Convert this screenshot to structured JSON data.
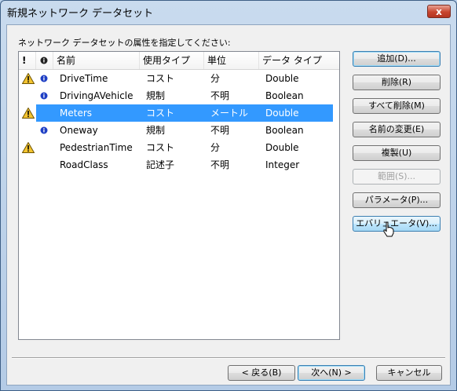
{
  "window": {
    "title": "新規ネットワーク データセット",
    "close_label": "x"
  },
  "prompt": "ネットワーク データセットの属性を指定してください:",
  "columns": {
    "col1": "!",
    "col3": "名前",
    "col4": "使用タイプ",
    "col5": "単位",
    "col6": "データ タイプ"
  },
  "rows": [
    {
      "name": "DriveTime",
      "usage": "コスト",
      "units": "分",
      "dtype": "Double",
      "warning": true,
      "info": true,
      "selected": false
    },
    {
      "name": "DrivingAVehicle",
      "usage": "規制",
      "units": "不明",
      "dtype": "Boolean",
      "warning": false,
      "info": true,
      "selected": false
    },
    {
      "name": "Meters",
      "usage": "コスト",
      "units": "メートル",
      "dtype": "Double",
      "warning": true,
      "info": false,
      "selected": true
    },
    {
      "name": "Oneway",
      "usage": "規制",
      "units": "不明",
      "dtype": "Boolean",
      "warning": false,
      "info": true,
      "selected": false
    },
    {
      "name": "PedestrianTime",
      "usage": "コスト",
      "units": "分",
      "dtype": "Double",
      "warning": true,
      "info": false,
      "selected": false
    },
    {
      "name": "RoadClass",
      "usage": "記述子",
      "units": "不明",
      "dtype": "Integer",
      "warning": false,
      "info": false,
      "selected": false
    }
  ],
  "buttons": {
    "add": "追加(D)...",
    "remove": "削除(R)",
    "remove_all": "すべて削除(M)",
    "rename": "名前の変更(E)",
    "duplicate": "複製(U)",
    "ranges": "範囲(S)...",
    "parameters": "パラメータ(P)...",
    "evaluators": "エバリュエータ(V)..."
  },
  "footer": {
    "back": "< 戻る(B)",
    "next": "次へ(N) >",
    "cancel": "キャンセル"
  },
  "colors": {
    "selection": "#3399ff",
    "info_icon": "#1f3fc4",
    "warning_icon": "#f4c430"
  }
}
